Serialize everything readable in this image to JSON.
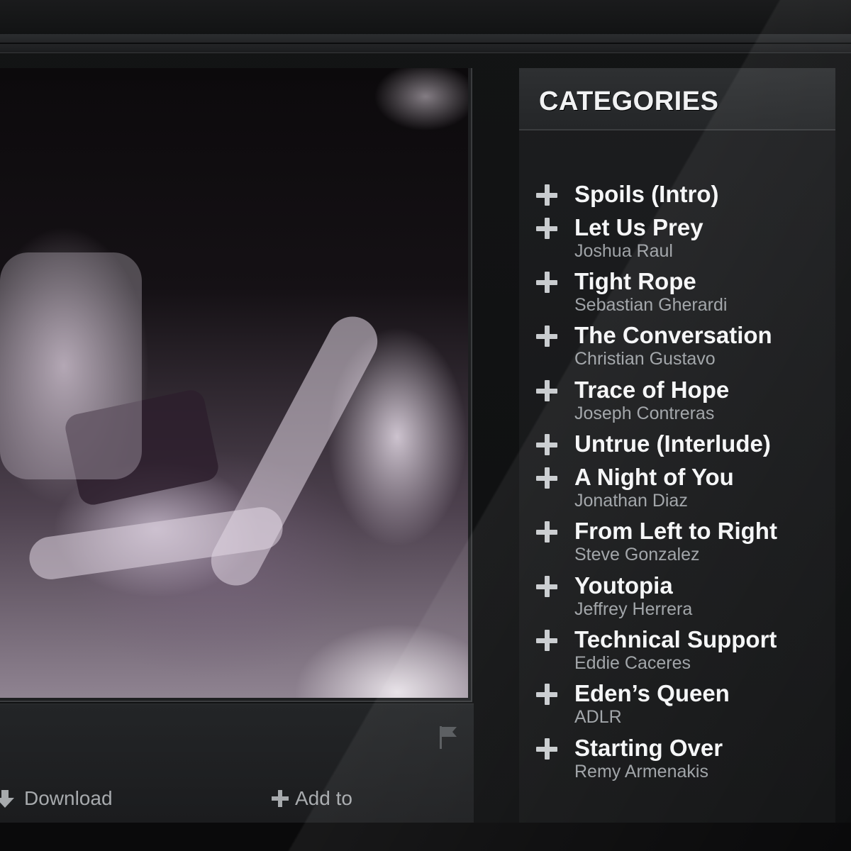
{
  "sidebar": {
    "title": "CATEGORIES",
    "items": [
      {
        "title": "Spoils (Intro)",
        "artist": ""
      },
      {
        "title": "Let Us Prey",
        "artist": "Joshua Raul"
      },
      {
        "title": "Tight Rope",
        "artist": "Sebastian Gherardi"
      },
      {
        "title": "The Conversation",
        "artist": "Christian Gustavo"
      },
      {
        "title": "Trace of Hope",
        "artist": "Joseph Contreras"
      },
      {
        "title": "Untrue (Interlude)",
        "artist": ""
      },
      {
        "title": "A Night of You",
        "artist": "Jonathan Diaz"
      },
      {
        "title": "From Left to Right",
        "artist": "Steve Gonzalez"
      },
      {
        "title": "Youtopia",
        "artist": "Jeffrey Herrera"
      },
      {
        "title": "Technical Support",
        "artist": "Eddie Caceres"
      },
      {
        "title": "Eden’s Queen",
        "artist": "ADLR"
      },
      {
        "title": "Starting Over",
        "artist": "Remy Armenakis"
      }
    ]
  },
  "actions": {
    "download_label": "Download",
    "download_icon": "download-arrow-icon",
    "add_to_label": "Add to",
    "add_to_icon": "plus-icon",
    "flag_icon": "flag-icon"
  },
  "colors": {
    "background": "#131415",
    "sidebar_header": "#2e3032",
    "title_text": "#f5f6f7",
    "artist_text": "#9fa3a7",
    "action_text": "#a7aaad",
    "plus_icon": "#c9cccf"
  }
}
